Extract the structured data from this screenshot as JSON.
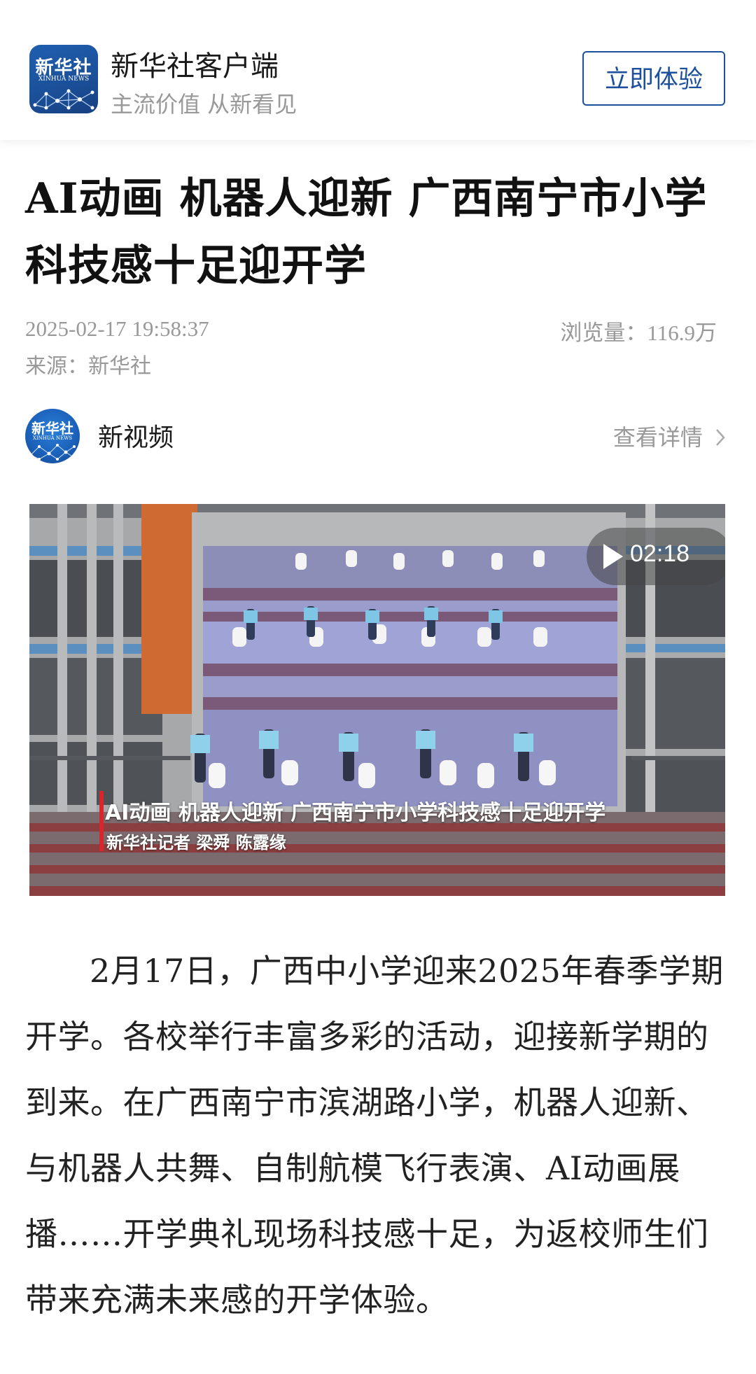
{
  "app_bar": {
    "logo_text": "新华社",
    "logo_subtext": "XINHUA NEWS",
    "app_name": "新华社客户端",
    "slogan": "主流价值 从新看见",
    "try_button": "立即体验"
  },
  "article": {
    "title": "AI动画 机器人迎新 广西南宁市小学科技感十足迎开学",
    "datetime": "2025-02-17 19:58:37",
    "source": "来源：新华社",
    "views_label": "浏览量：",
    "views_value": "116.9万",
    "body": "2月17日，广西中小学迎来2025年春季学期开学。各校举行丰富多彩的活动，迎接新学期的到来。在广西南宁市滨湖路小学，机器人迎新、与机器人共舞、自制航模飞行表演、AI动画展播……开学典礼现场科技感十足，为返校师生们带来充满未来感的开学体验。"
  },
  "channel": {
    "logo_text": "新华社",
    "logo_subtext": "XINHUA NEWS",
    "name": "新视频",
    "detail_link": "查看详情",
    "detail_icon": "chevron-right-icon"
  },
  "video": {
    "duration": "02:18",
    "play_icon": "play-icon",
    "caption_title": "AI动画 机器人迎新 广西南宁市小学科技感十足迎开学",
    "caption_credit": "新华社记者 梁舜 陈露缘"
  },
  "colors": {
    "brand_blue": "#1c4f9c",
    "caption_red": "#d8262c",
    "muted_text": "#999999"
  }
}
